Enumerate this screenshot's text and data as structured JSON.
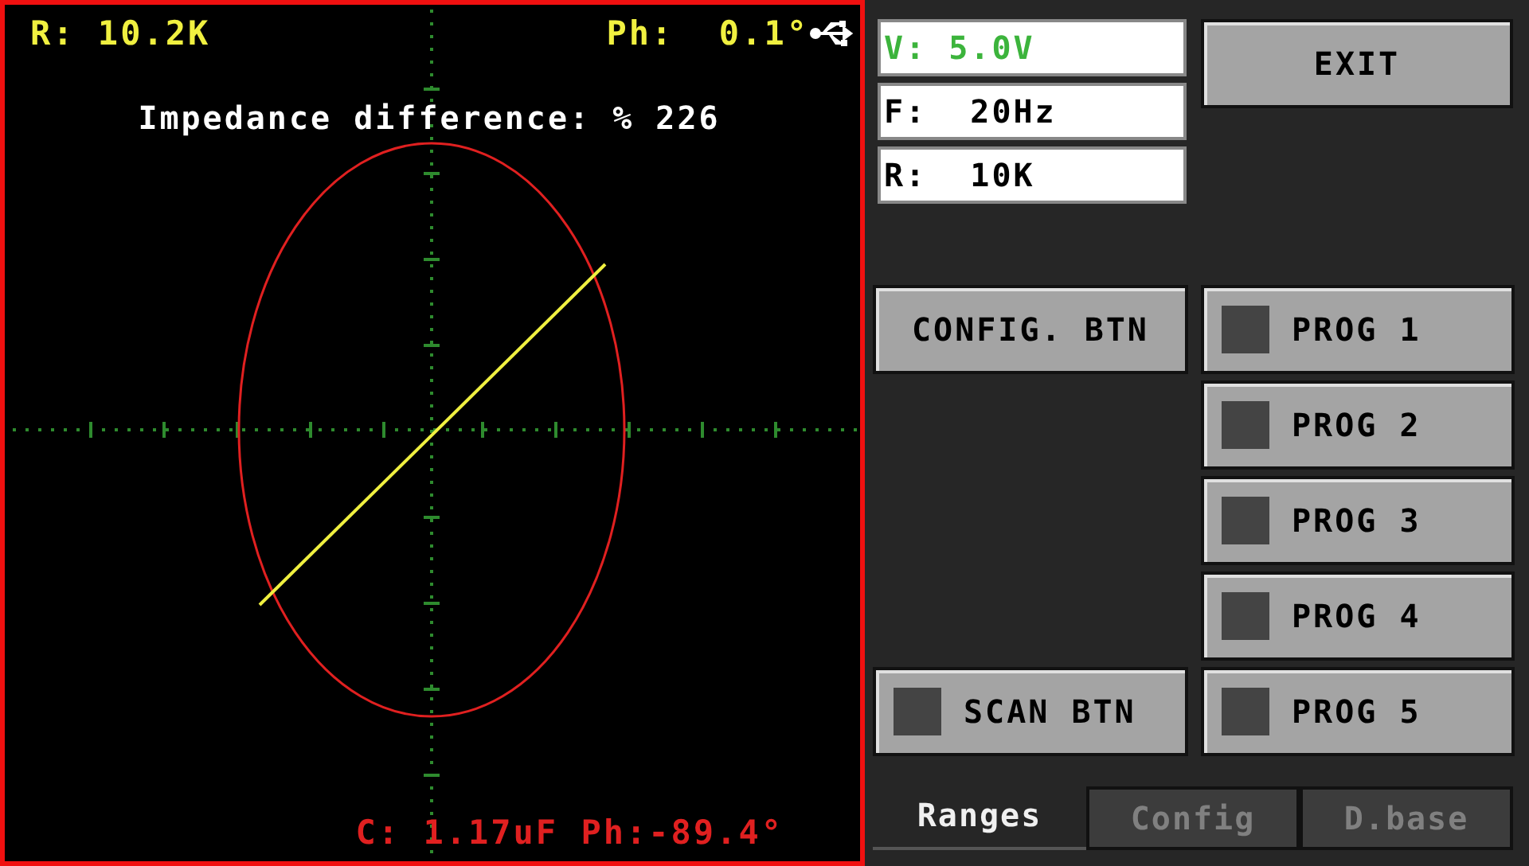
{
  "scope": {
    "resistance": "R: 10.2K",
    "phase": "Ph:  0.1°",
    "title": "Impedance difference: % 226",
    "result": "C: 1.17uF Ph:-89.4°"
  },
  "settings": [
    {
      "text": "V: 5.0V",
      "selected": true
    },
    {
      "text": "F:  20Hz",
      "selected": false
    },
    {
      "text": "R:  10K",
      "selected": false
    }
  ],
  "exit_button": "EXIT",
  "config_button": "CONFIG. BTN",
  "scan_button": {
    "label": "SCAN BTN",
    "on": false
  },
  "programs": [
    {
      "label": "PROG 1",
      "on": false
    },
    {
      "label": "PROG 2",
      "on": false
    },
    {
      "label": "PROG 3",
      "on": false
    },
    {
      "label": "PROG 4",
      "on": false
    },
    {
      "label": "PROG 5",
      "on": false
    }
  ],
  "tabs": [
    {
      "label": "Ranges",
      "selected": true
    },
    {
      "label": "Config",
      "selected": false
    },
    {
      "label": "D.base",
      "selected": false
    }
  ]
}
